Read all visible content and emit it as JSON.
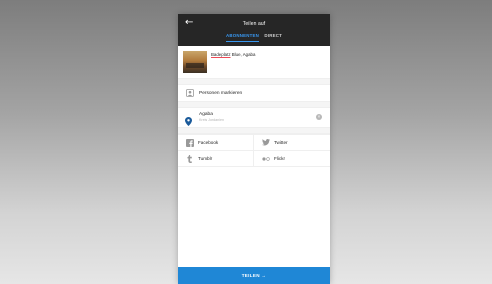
{
  "header": {
    "title": "Teilen auf",
    "tabs": [
      {
        "label": "ABONNENTEN",
        "active": true
      },
      {
        "label": "DIRECT",
        "active": false
      }
    ]
  },
  "post": {
    "caption_link": "Badeplatz",
    "caption_rest": " Blue, Agaba"
  },
  "options": {
    "tag_people": "Personen markieren"
  },
  "location": {
    "name": "Agaba",
    "sub": "Kreis Jordanien"
  },
  "social": [
    {
      "label": "Facebook",
      "icon": "facebook-icon"
    },
    {
      "label": "Twitter",
      "icon": "twitter-icon"
    },
    {
      "label": "Tumblr",
      "icon": "tumblr-icon"
    },
    {
      "label": "Flickr",
      "icon": "flickr-icon"
    }
  ],
  "share_button": "TEILEN →",
  "colors": {
    "header_bg": "#262626",
    "accent": "#3897f0",
    "share_bg": "#1f87d6",
    "pin": "#1a5a9a"
  }
}
